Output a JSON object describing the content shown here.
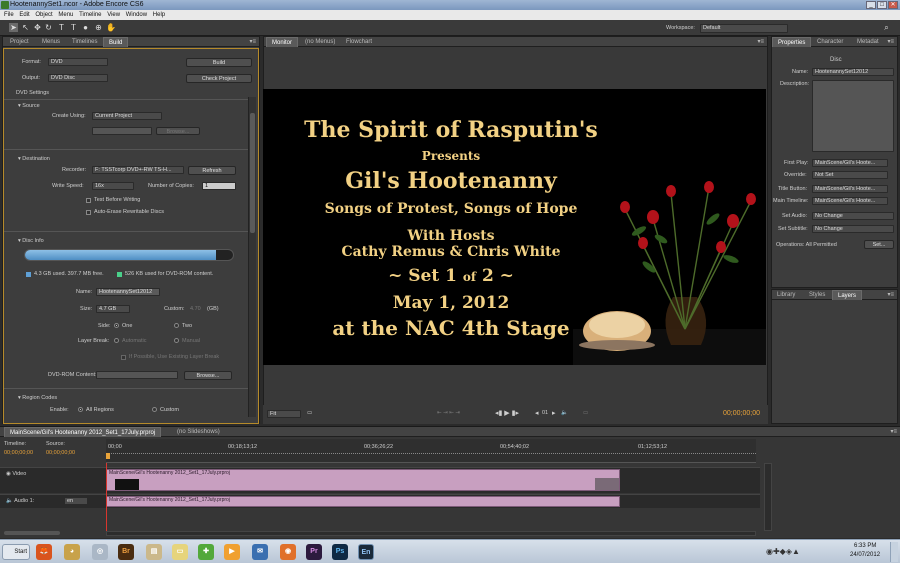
{
  "app": {
    "window_title": "HootenannySet1.ncor - Adobe Encore CS6",
    "menu": [
      "File",
      "Edit",
      "Object",
      "Menu",
      "Timeline",
      "View",
      "Window",
      "Help"
    ],
    "workspace_label": "Workspace:",
    "workspace_value": "Default"
  },
  "left_panel": {
    "tabs": [
      "Project",
      "Menus",
      "Timelines",
      "Build"
    ],
    "format_label": "Format:",
    "format_value": "DVD",
    "output_label": "Output:",
    "output_value": "DVD Disc",
    "build_button": "Build",
    "check_project_button": "Check Project",
    "dvd_settings": "DVD Settings",
    "source_section": "Source",
    "create_using_label": "Create Using:",
    "create_using_value": "Current Project",
    "browse_disabled": "Browse...",
    "destination_section": "Destination",
    "recorder_label": "Recorder:",
    "recorder_value": "F: TSSTcorp DVD+-RW TS-H...",
    "refresh_button": "Refresh",
    "write_speed_label": "Write Speed:",
    "write_speed_value": "16x",
    "copies_label": "Number of Copies:",
    "copies_value": "1",
    "test_before_writing": "Test Before Writing",
    "auto_erase": "Auto-Erase Rewritable Discs",
    "disc_info_section": "Disc Info",
    "usage_used": "4.3 GB used.  397.7 MB free.",
    "usage_rom": "526 KB used for DVD-ROM content.",
    "disc_usage_fraction": 0.92,
    "name_label": "Name:",
    "name_value": "HootenannySet12012",
    "size_label": "Size:",
    "size_value": "4.7 GB",
    "custom_label": "Custom:",
    "custom_value": "4.70",
    "custom_unit": "(GB)",
    "side_label": "Side:",
    "side_one": "One",
    "side_two": "Two",
    "layer_break_label": "Layer Break:",
    "layer_auto": "Automatic",
    "layer_manual": "Manual",
    "layer_note": "If Possible, Use Existing Layer Break",
    "rom_label": "DVD-ROM Content:",
    "rom_browse": "Browse...",
    "region_section": "Region Codes",
    "enable_label": "Enable:",
    "all_regions": "All Regions",
    "custom_region": "Custom"
  },
  "monitor": {
    "tabs": [
      "Monitor",
      "(no Menus)",
      "Flowchart"
    ],
    "slide_lines": [
      "The Spirit of Rasputin's",
      "Presents",
      "Gil's Hootenanny",
      "Songs of Protest, Songs of Hope",
      "With Hosts",
      "Cathy Remus & Chris White",
      "~ Set 1",
      "of",
      "2 ~",
      "May 1, 2012",
      "at the NAC 4th Stage"
    ],
    "fit_value": "Fit",
    "chapter_value": "01",
    "timecode": "00;00;00;00"
  },
  "properties": {
    "tabs": [
      "Properties",
      "Character",
      "Metadat"
    ],
    "type": "Disc",
    "name_label": "Name:",
    "name_value": "HootenannySet12012",
    "description_label": "Description:",
    "first_play_label": "First Play:",
    "first_play_value": "MainScene/Gil's Hoote...",
    "override_label": "Override:",
    "override_value": "Not Set",
    "title_button_label": "Title Button:",
    "title_button_value": "MainScene/Gil's Hoote...",
    "main_timeline_label": "Main Timeline:",
    "main_timeline_value": "MainScene/Gil's Hoote...",
    "set_audio_label": "Set Audio:",
    "set_audio_value": "No Change",
    "set_subtitle_label": "Set Subtitle:",
    "set_subtitle_value": "No Change",
    "operations_label": "Operations: All Permitted",
    "set_button": "Set...",
    "lower_tabs": [
      "Library",
      "Styles",
      "Layers"
    ]
  },
  "timeline": {
    "tab": "MainScene/Gil's Hootenanny 2012_Set1_17July.prproj",
    "tab2": "(no Slideshows)",
    "timeline_label": "Timeline:",
    "source_label": "Source:",
    "timeline_tc": "00;00;00;00",
    "source_tc": "00;00;00;00",
    "ruler": [
      "00;00",
      "00;18;13;12",
      "00;36;26;22",
      "00;54;40;02",
      "01;12;53;12"
    ],
    "video_label": "Video",
    "audio_label": "Audio 1:",
    "audio_lang": "en",
    "video_clip": "MainScene/Gil's Hootenanny 2012_Set1_17July.prproj",
    "audio_clip": "MainScene/Gil's Hootenanny 2012_Set1_17July.prproj"
  },
  "taskbar": {
    "start": "Start",
    "apps": [
      "Br",
      "Pr",
      "Ps",
      "En"
    ],
    "time": "6:33 PM",
    "date": "24/07/2012"
  }
}
